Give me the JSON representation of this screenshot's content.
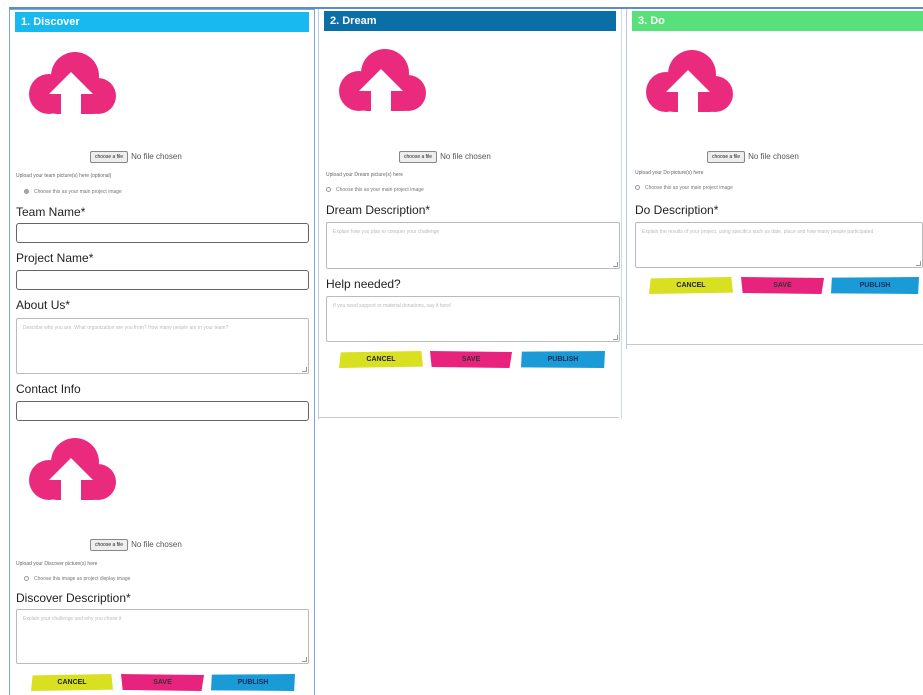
{
  "panels": {
    "discover": {
      "title": "1. Discover",
      "header_color": "#17b9f0",
      "upload1": {
        "button": "choose a file",
        "status": "No file chosen",
        "hint": "Upload your team picture(s) here (optional)",
        "radio": "Choose this as your main project image"
      },
      "team_name_label": "Team Name*",
      "project_name_label": "Project Name*",
      "about_label": "About Us*",
      "about_placeholder": "Describe who you are. What organization are you from? How many people are in your team?",
      "contact_label": "Contact Info",
      "upload2": {
        "button": "choose a file",
        "status": "No file chosen",
        "hint": "Upload your Discover picture(s) here",
        "radio": "Choose this image as project display image"
      },
      "description_label": "Discover Description*",
      "description_placeholder": "Explain your challenge and why you chose it",
      "buttons": {
        "cancel": "CANCEL",
        "save": "SAVE",
        "publish": "PUBLISH"
      }
    },
    "dream": {
      "title": "2. Dream",
      "header_color": "#0a6fa6",
      "upload": {
        "button": "choose a file",
        "status": "No file chosen",
        "hint": "Upload your Dream picture(s) here",
        "radio": "Choose this as your main project image"
      },
      "description_label": "Dream Description*",
      "description_placeholder": "Explain how you plan to conquer your challenge",
      "help_label": "Help needed?",
      "help_placeholder": "If you need support or material donations, say it here!",
      "buttons": {
        "cancel": "CANCEL",
        "save": "SAVE",
        "publish": "PUBLISH"
      }
    },
    "do": {
      "title": "3. Do",
      "header_color": "#58e07a",
      "upload": {
        "button": "choose a file",
        "status": "No file chosen",
        "hint": "Upload your Do picture(s) here",
        "radio": "Choose this as your main project image"
      },
      "description_label": "Do Description*",
      "description_placeholder": "Explain the results of your project, using specifics such as date, place and how many people participated",
      "buttons": {
        "cancel": "CANCEL",
        "save": "SAVE",
        "publish": "PUBLISH"
      }
    }
  },
  "colors": {
    "upload_icon": "#ea2a7d",
    "cancel": "#d8e021",
    "save": "#e8237e",
    "publish": "#1a9ad6"
  },
  "icons": {
    "upload": "cloud-upload-icon"
  }
}
